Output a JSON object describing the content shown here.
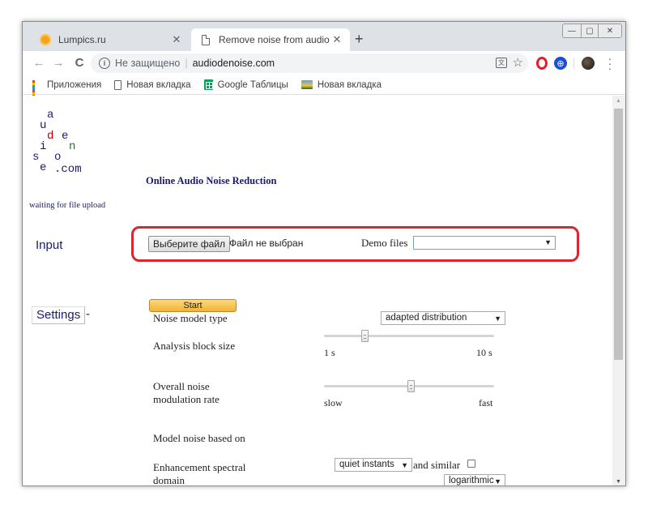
{
  "tabs": [
    {
      "title": "Lumpics.ru",
      "active": false
    },
    {
      "title": "Remove noise from audio files o",
      "active": true
    }
  ],
  "window": {
    "minimize": "—",
    "maximize": "▢",
    "close": "✕"
  },
  "toolbar": {
    "security_label": "Не защищено",
    "separator": "|",
    "url": "audiodenoise.com"
  },
  "bookmarks": [
    {
      "label": "Приложения",
      "icon": "apps-icon"
    },
    {
      "label": "Новая вкладка",
      "icon": "doc-icon"
    },
    {
      "label": "Google Таблицы",
      "icon": "sheets-icon"
    },
    {
      "label": "Новая вкладка",
      "icon": "image-icon"
    }
  ],
  "logo": {
    "letters": [
      "a",
      "u",
      "d",
      "e",
      "i",
      "n",
      "s",
      "o",
      "e",
      ".com"
    ],
    "colors": [
      "#1a1a73",
      "#1a1a73",
      "#b00000",
      "#1a1a73",
      "#1a1a73",
      "#1a7a1a",
      "#1a1a73",
      "#1a1a73",
      "#1a1a73",
      "#1a1a73"
    ]
  },
  "page": {
    "title": "Online Audio Noise Reduction",
    "status": "waiting for file upload",
    "input_label": "Input",
    "file_button": "Выберите файл",
    "file_status": "Файл не выбран",
    "demo_label": "Demo files",
    "demo_value": "",
    "start_button": "Start",
    "settings_label": "Settings",
    "settings_toggle": "-"
  },
  "settings": {
    "noise_model_type": {
      "label": "Noise model type",
      "value": "adapted distribution"
    },
    "analysis_block_size": {
      "label": "Analysis block size",
      "min_label": "1 s",
      "max_label": "10 s",
      "level": 0.24
    },
    "modulation_rate": {
      "label_line1": "Overall noise",
      "label_line2": "modulation rate",
      "min_label": "slow",
      "max_label": "fast",
      "level": 0.51
    },
    "model_noise_based_on": {
      "label": "Model noise based on",
      "value": "quiet instants",
      "suffix": "and similar",
      "checked": false
    },
    "spectral_domain": {
      "label_line1": "Enhancement spectral",
      "label_line2": "domain",
      "value": "logarithmic"
    }
  },
  "colors": {
    "accent_red": "#d9262f",
    "page_text_blue": "#1a1a73",
    "start_yellow": "#f0b33a"
  }
}
